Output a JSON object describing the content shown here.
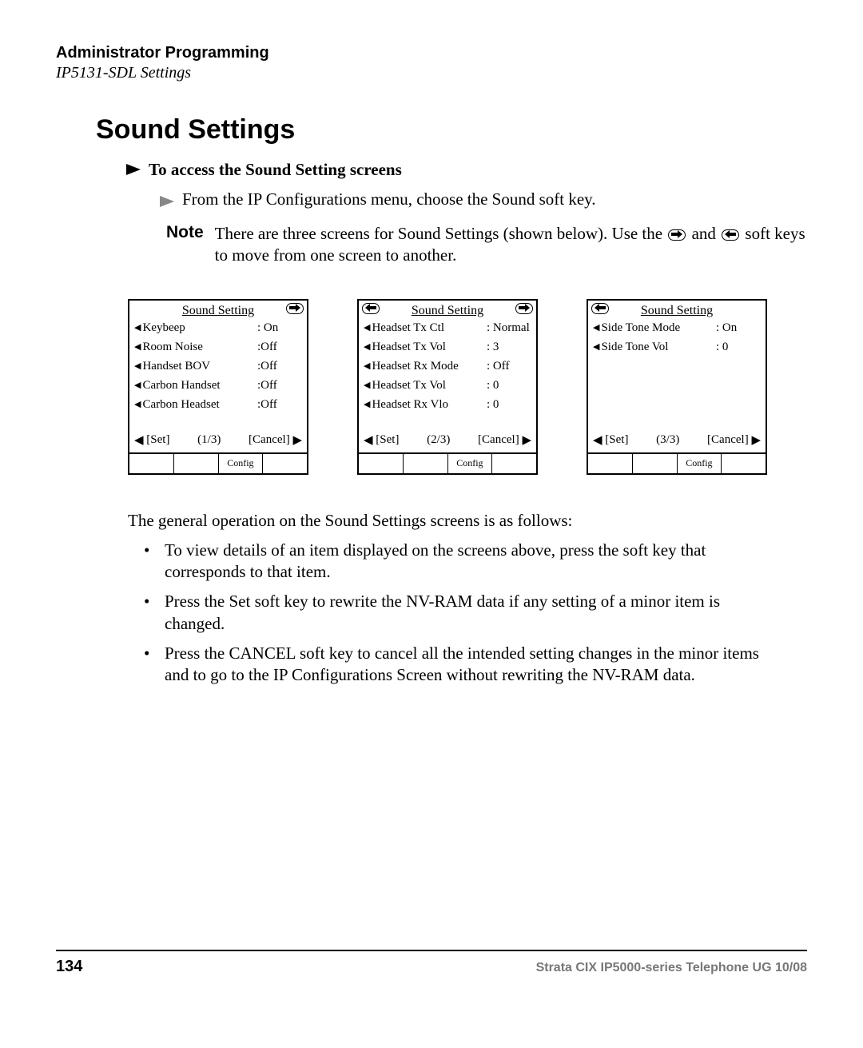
{
  "header": {
    "section": "Administrator Programming",
    "subsection": "IP5131-SDL Settings"
  },
  "title": "Sound Settings",
  "access": {
    "heading": "To access the Sound Setting screens",
    "instruction": "From the IP Configurations menu, choose the Sound soft key."
  },
  "note": {
    "label": "Note",
    "text1": "There are three screens for Sound Settings (shown below). Use the ",
    "text2": " and ",
    "text3": " soft keys to move from one screen to another."
  },
  "screens": [
    {
      "title": "Sound Setting",
      "items": [
        {
          "label": "Keybeep",
          "value": ": On"
        },
        {
          "label": "Room Noise",
          "value": ":Off"
        },
        {
          "label": "Handset BOV",
          "value": ":Off"
        },
        {
          "label": "Carbon Handset",
          "value": ":Off"
        },
        {
          "label": "Carbon Headset",
          "value": ":Off"
        }
      ],
      "foot": {
        "set": "[Set]",
        "page": "(1/3)",
        "cancel": "[Cancel]"
      },
      "softkey": "Config"
    },
    {
      "title": "Sound Setting",
      "items": [
        {
          "label": "Headset Tx Ctl",
          "value": ": Normal"
        },
        {
          "label": "Headset Tx Vol",
          "value": ": 3"
        },
        {
          "label": "Headset Rx Mode",
          "value": ": Off"
        },
        {
          "label": "Headset Tx Vol",
          "value": ": 0"
        },
        {
          "label": "Headset Rx Vlo",
          "value": ": 0"
        }
      ],
      "foot": {
        "set": "[Set]",
        "page": "(2/3)",
        "cancel": "[Cancel]"
      },
      "softkey": "Config"
    },
    {
      "title": "Sound Setting",
      "items": [
        {
          "label": "Side Tone Mode",
          "value": ": On"
        },
        {
          "label": "Side Tone Vol",
          "value": ": 0"
        }
      ],
      "foot": {
        "set": "[Set]",
        "page": "(3/3)",
        "cancel": "[Cancel]"
      },
      "softkey": "Config"
    }
  ],
  "body": {
    "intro": "The general operation on the Sound Settings screens is as follows:",
    "bullets": [
      "To view details of an item displayed on the screens above, press the soft key that corresponds to that item.",
      "Press the Set soft key to rewrite the NV-RAM data if any setting of a minor item is changed.",
      "Press the CANCEL soft key to cancel all the intended setting changes in the minor items and to go to the IP Configurations Screen without rewriting the NV-RAM data."
    ]
  },
  "footer": {
    "page": "134",
    "doc": "Strata CIX IP5000-series Telephone UG    10/08"
  }
}
